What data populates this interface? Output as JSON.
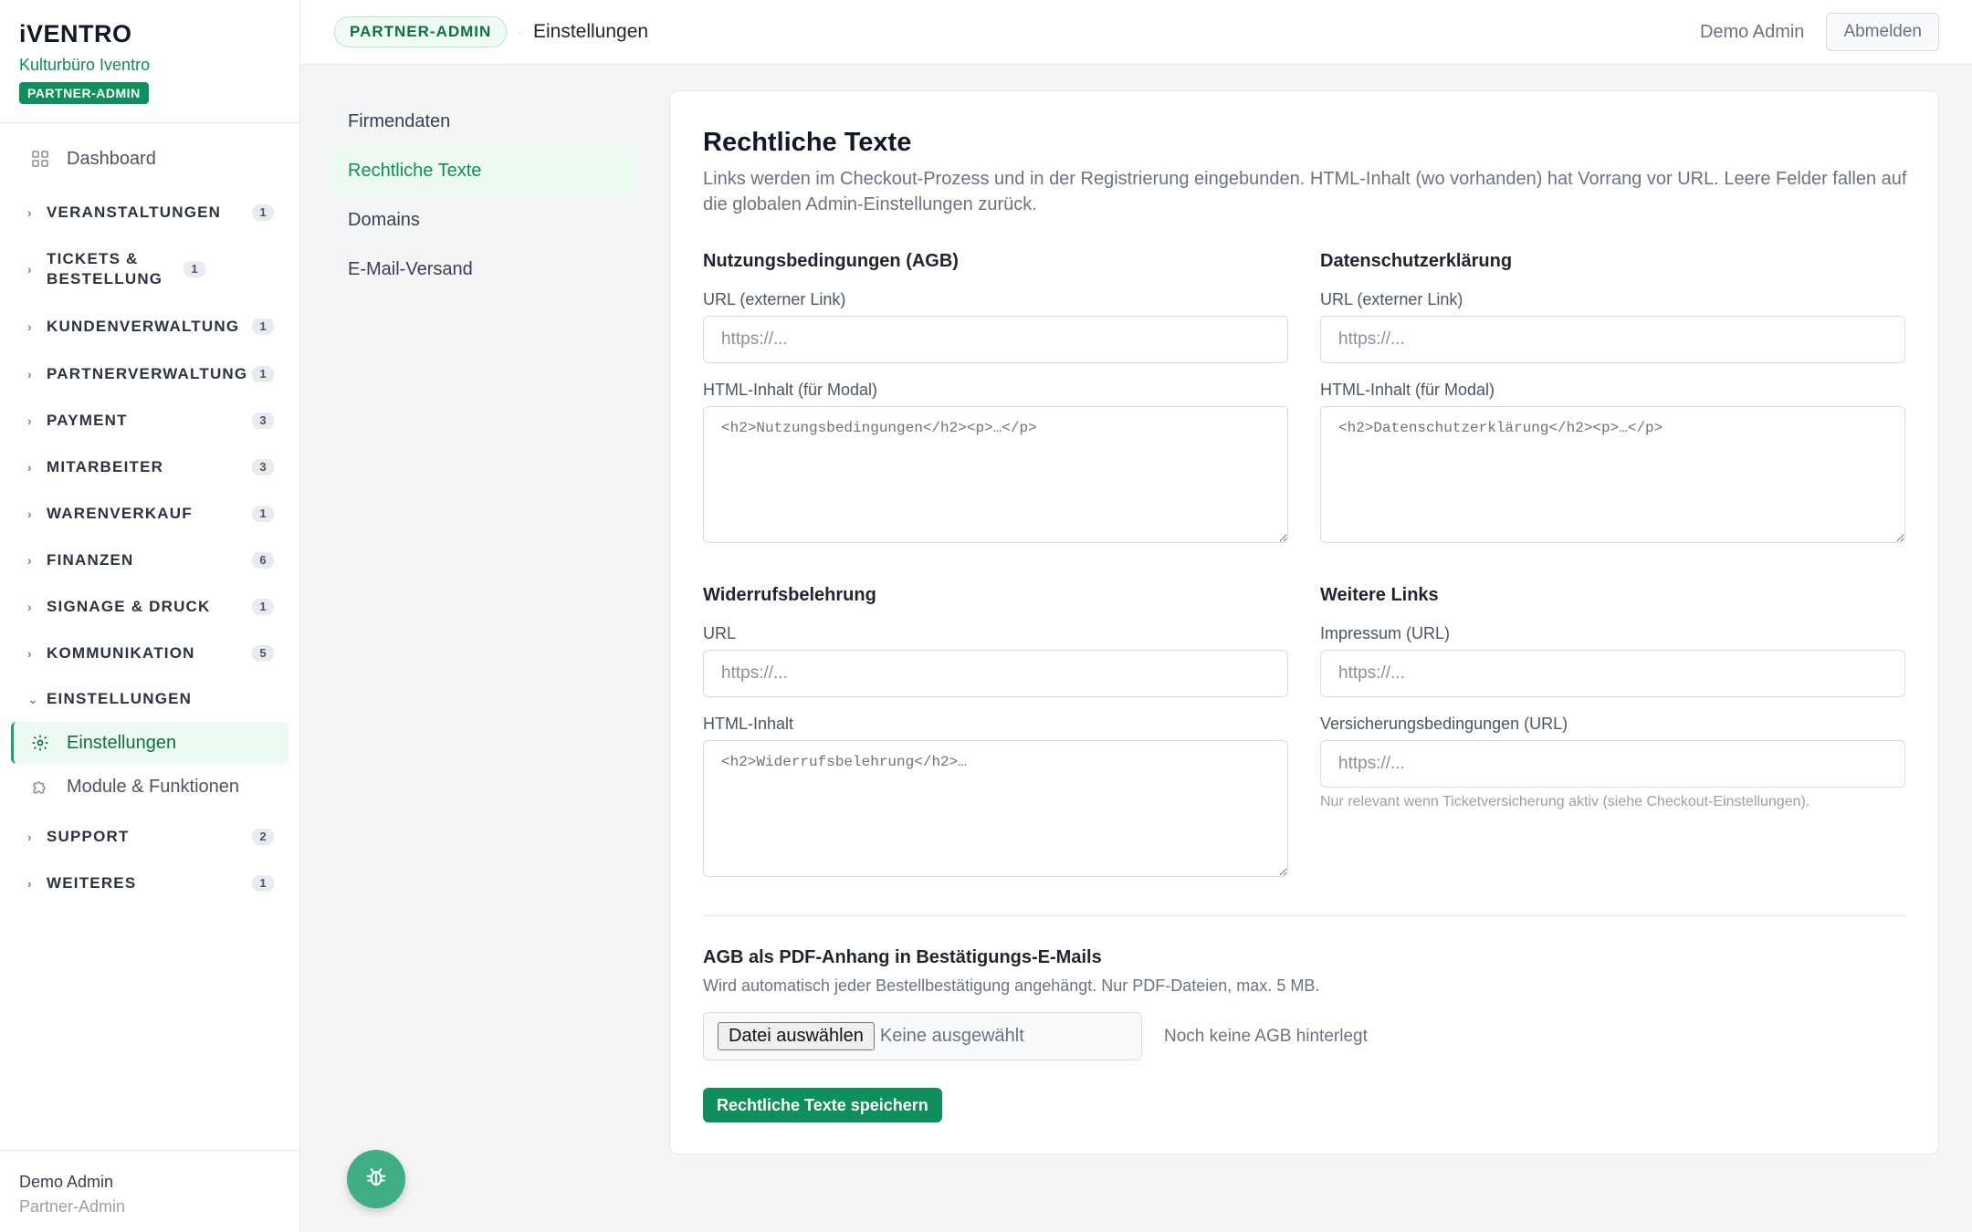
{
  "brand": {
    "logo": "iVENTRO",
    "org": "Kulturbüro Iventro",
    "role_badge": "PARTNER-ADMIN"
  },
  "sidebar": {
    "dashboard": "Dashboard",
    "groups": [
      {
        "label": "VERANSTALTUNGEN",
        "count": "1"
      },
      {
        "label": "TICKETS & BESTELLUNG",
        "count": "1"
      },
      {
        "label": "KUNDENVERWALTUNG",
        "count": "1"
      },
      {
        "label": "PARTNERVERWALTUNG",
        "count": "1"
      },
      {
        "label": "PAYMENT",
        "count": "3"
      },
      {
        "label": "MITARBEITER",
        "count": "3"
      },
      {
        "label": "WARENVERKAUF",
        "count": "1"
      },
      {
        "label": "FINANZEN",
        "count": "6"
      },
      {
        "label": "SIGNAGE & DRUCK",
        "count": "1"
      },
      {
        "label": "KOMMUNIKATION",
        "count": "5"
      },
      {
        "label": "EINSTELLUNGEN",
        "count": ""
      },
      {
        "label": "SUPPORT",
        "count": "2"
      },
      {
        "label": "WEITERES",
        "count": "1"
      }
    ],
    "settings_children": [
      "Einstellungen",
      "Module & Funktionen"
    ],
    "footer": {
      "name": "Demo Admin",
      "role": "Partner-Admin"
    }
  },
  "header": {
    "badge": "PARTNER-ADMIN",
    "separator": "·",
    "title": "Einstellungen",
    "user": "Demo Admin",
    "logout": "Abmelden"
  },
  "subnav": [
    "Firmendaten",
    "Rechtliche Texte",
    "Domains",
    "E-Mail-Versand"
  ],
  "main": {
    "title": "Rechtliche Texte",
    "description": "Links werden im Checkout-Prozess und in der Registrierung eingebunden. HTML-Inhalt (wo vorhanden) hat Vorrang vor URL. Leere Felder fallen auf die globalen Admin-Einstellungen zurück.",
    "agb": {
      "title": "Nutzungsbedingungen (AGB)",
      "url_label": "URL (externer Link)",
      "url_placeholder": "https://...",
      "html_label": "HTML-Inhalt (für Modal)",
      "html_placeholder": "<h2>Nutzungsbedingungen</h2><p>…</p>"
    },
    "privacy": {
      "title": "Datenschutzerklärung",
      "url_label": "URL (externer Link)",
      "url_placeholder": "https://...",
      "html_label": "HTML-Inhalt (für Modal)",
      "html_placeholder": "<h2>Datenschutzerklärung</h2><p>…</p>"
    },
    "withdrawal": {
      "title": "Widerrufsbelehrung",
      "url_label": "URL",
      "url_placeholder": "https://...",
      "html_label": "HTML-Inhalt",
      "html_placeholder": "<h2>Widerrufsbelehrung</h2>…"
    },
    "more_links": {
      "title": "Weitere Links",
      "imprint_label": "Impressum (URL)",
      "imprint_placeholder": "https://...",
      "insurance_label": "Versicherungsbedingungen (URL)",
      "insurance_placeholder": "https://...",
      "insurance_hint": "Nur relevant wenn Ticketversicherung aktiv (siehe Checkout-Einstellungen)."
    },
    "pdf": {
      "title": "AGB als PDF-Anhang in Bestätigungs-E-Mails",
      "description": "Wird automatisch jeder Bestellbestätigung angehängt. Nur PDF-Dateien, max. 5 MB.",
      "choose_button": "Datei auswählen",
      "none_selected": "Keine ausgewählt",
      "status": "Noch keine AGB hinterlegt"
    },
    "save_button": "Rechtliche Texte speichern"
  },
  "icons": {
    "dashboard": "grid-icon",
    "settings": "gear-icon",
    "modules": "puzzle-icon",
    "fab": "bug-icon"
  },
  "colors": {
    "accent": "#0f8f5c",
    "accent_light": "#ecfaf2"
  }
}
